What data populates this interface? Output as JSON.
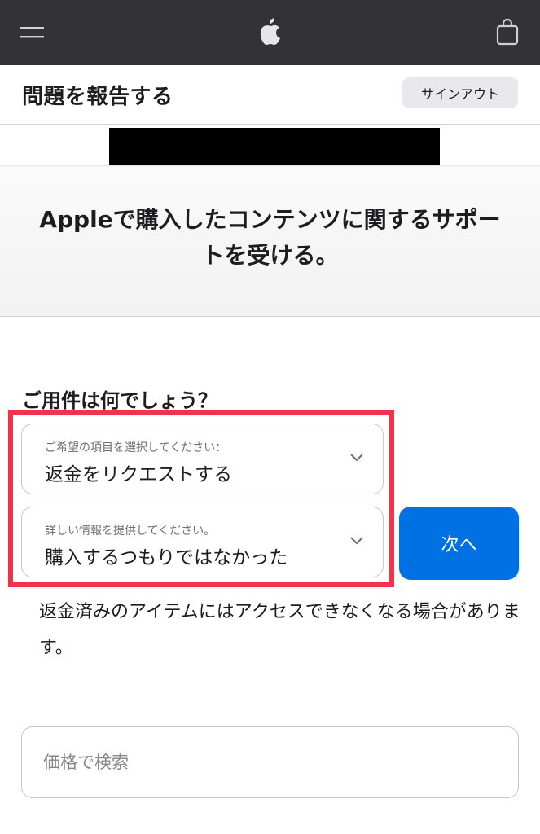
{
  "header": {
    "menu_icon": "hamburger-menu-icon",
    "logo_icon": "apple-logo-icon",
    "bag_icon": "shopping-bag-icon",
    "background": "#333336"
  },
  "subheader": {
    "title": "問題を報告する",
    "signout_label": "サインアウト"
  },
  "hero": {
    "text": "Appleで購入したコンテンツに関するサポートを受ける。"
  },
  "form": {
    "question": "ご用件は何でしょう？",
    "select_1": {
      "label": "ご希望の項目を選択してください：",
      "value": "返金をリクエストする"
    },
    "select_2": {
      "label": "詳しい情報を提供してください。",
      "value": "購入するつもりではなかった"
    },
    "next_label": "次へ",
    "note": "返金済みのアイテムにはアクセスできなくなる場合があります。",
    "search_placeholder": "価格で検索",
    "accent_color": "#0071e3",
    "highlight_color": "#f2344a"
  }
}
